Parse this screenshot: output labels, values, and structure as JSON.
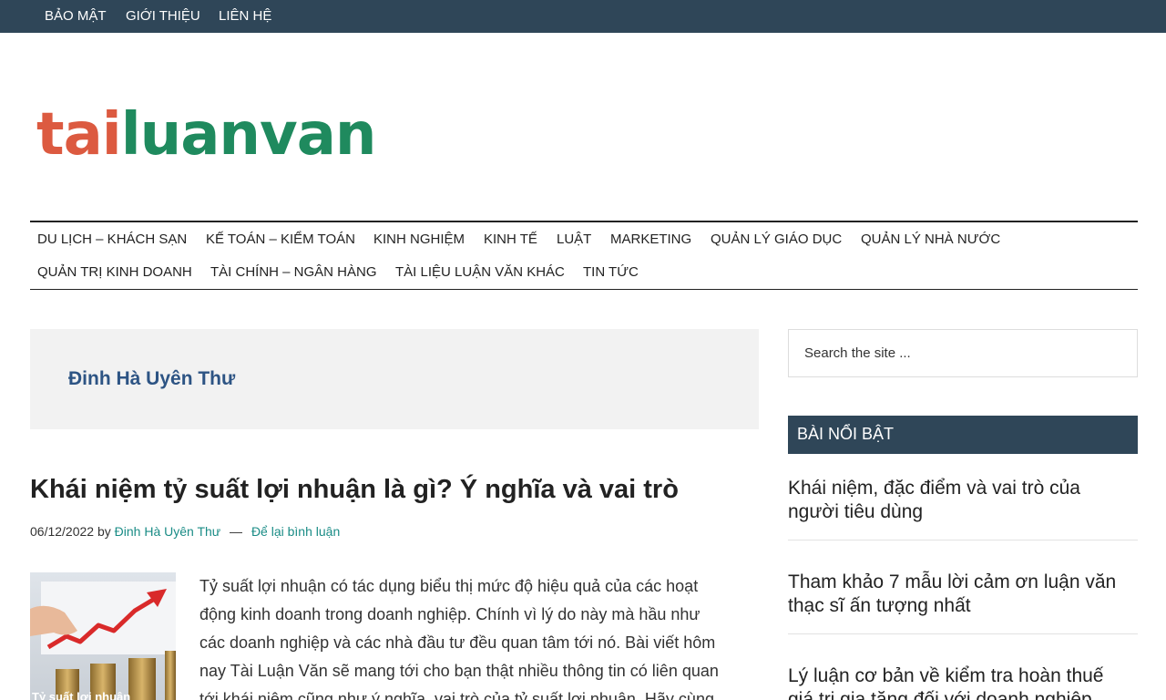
{
  "top_nav": [
    "BẢO MẬT",
    "GIỚI THIỆU",
    "LIÊN HỆ"
  ],
  "logo": {
    "part1": "tai",
    "part2": "luanvan",
    "color1": "#dc5a40",
    "color2": "#1f8a5e"
  },
  "main_nav": [
    "DU LỊCH – KHÁCH SẠN",
    "KẾ TOÁN – KIỂM TOÁN",
    "KINH NGHIỆM",
    "KINH TẾ",
    "LUẬT",
    "MARKETING",
    "QUẢN LÝ GIÁO DỤC",
    "QUẢN LÝ NHÀ NƯỚC",
    "QUẢN TRỊ KINH DOANH",
    "TÀI CHÍNH – NGÂN HÀNG",
    "TÀI LIỆU LUẬN VĂN KHÁC",
    "TIN TỨC"
  ],
  "author_box": {
    "title": "Đinh Hà Uyên Thư"
  },
  "post": {
    "title": "Khái niệm tỷ suất lợi nhuận là gì? Ý nghĩa và vai trò",
    "date": "06/12/2022",
    "by": "by",
    "author": "Đinh Hà Uyên Thư",
    "separator": "—",
    "comment_link": "Để lại bình luận",
    "excerpt": [
      "Tỷ suất lợi nhuận có tác dụng biểu thị mức độ hiệu quả của các hoạt",
      "động kinh doanh trong doanh nghiệp. Chính vì lý do này mà hầu như",
      "các doanh nghiệp và các nhà đầu tư đều quan tâm tới nó. Bài viết hôm",
      "nay Tài Luận Văn sẽ mang tới cho bạn thật nhiều thông tin có liên quan",
      "tới khái niệm cũng như ý nghĩa, vai trò của tỷ suất lợi nhuận. Hãy cùng"
    ],
    "thumb_caption": "Tỷ suất lợi nhuận"
  },
  "sidebar": {
    "search_placeholder": "Search the site ...",
    "widget_title": "BÀI NỔI BẬT",
    "featured": [
      [
        "Khái niệm, đặc điểm và vai trò của",
        "người tiêu dùng"
      ],
      [
        "Tham khảo 7 mẫu lời cảm ơn luận văn",
        "thạc sĩ ấn tượng nhất"
      ],
      [
        "Lý luận cơ bản về kiểm tra hoàn thuế",
        "giá trị gia tăng đối với doanh nghiệp"
      ]
    ]
  },
  "colors": {
    "header_bg": "#2f4658",
    "link": "#1a8c86",
    "author_title": "#2d5484"
  }
}
